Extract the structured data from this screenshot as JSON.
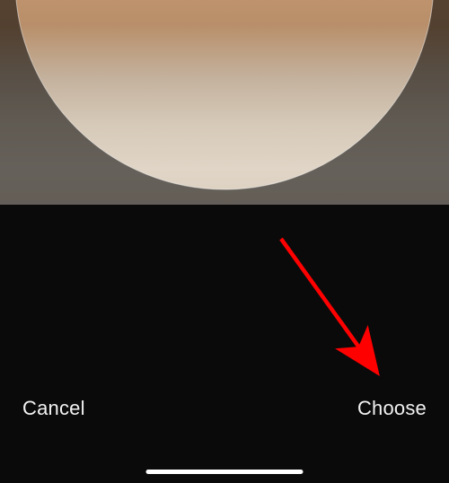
{
  "actions": {
    "cancel_label": "Cancel",
    "choose_label": "Choose"
  },
  "annotation": {
    "arrow_color": "#ff0000",
    "target": "choose-button"
  }
}
